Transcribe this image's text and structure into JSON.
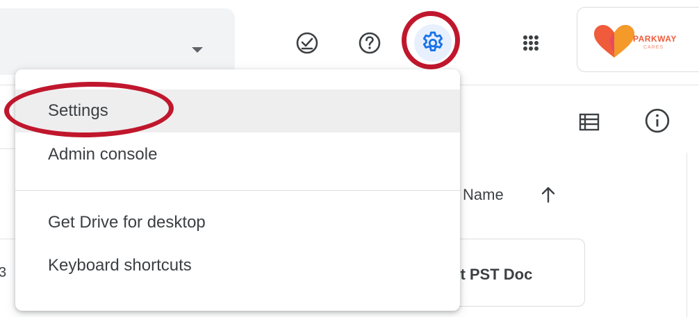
{
  "header": {
    "icons": {
      "ready_offline": "check-circle-icon",
      "support": "help-icon",
      "settings": "gear-icon",
      "apps": "apps-grid-icon"
    },
    "account_logo": {
      "text": "PARKWAY",
      "subtext": "CARES"
    }
  },
  "toolbar": {
    "list_view_icon": "list-view-icon",
    "info_icon": "info-icon"
  },
  "file_list": {
    "column_header": "Name",
    "sort_icon": "arrow-up-icon",
    "file_card_label": "nt PST Doc",
    "left_partial_text": "3"
  },
  "settings_menu": {
    "items": [
      {
        "label": "Settings"
      },
      {
        "label": "Admin console"
      },
      {
        "label": "Get Drive for desktop"
      },
      {
        "label": "Keyboard shortcuts"
      }
    ]
  },
  "colors": {
    "highlight_ring": "#c0172d",
    "settings_icon_blue": "#1a73e8",
    "active_item_bg": "#eeeeee",
    "logo_orange": "#ef5b3b"
  }
}
